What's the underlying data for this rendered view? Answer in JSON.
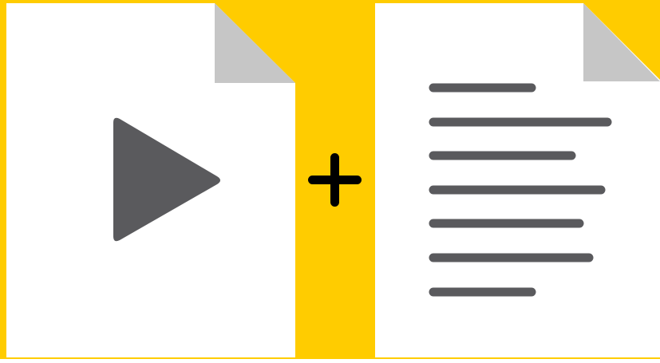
{
  "colors": {
    "background": "#FFCC00",
    "page": "#FFFFFF",
    "page_fold": "#C6C6C6",
    "icon": "#5A5A5D",
    "plus": "#000000"
  },
  "icons": {
    "video_file": "video-file-icon",
    "play": "play-icon",
    "plus": "plus-icon",
    "text_file": "text-document-icon"
  }
}
